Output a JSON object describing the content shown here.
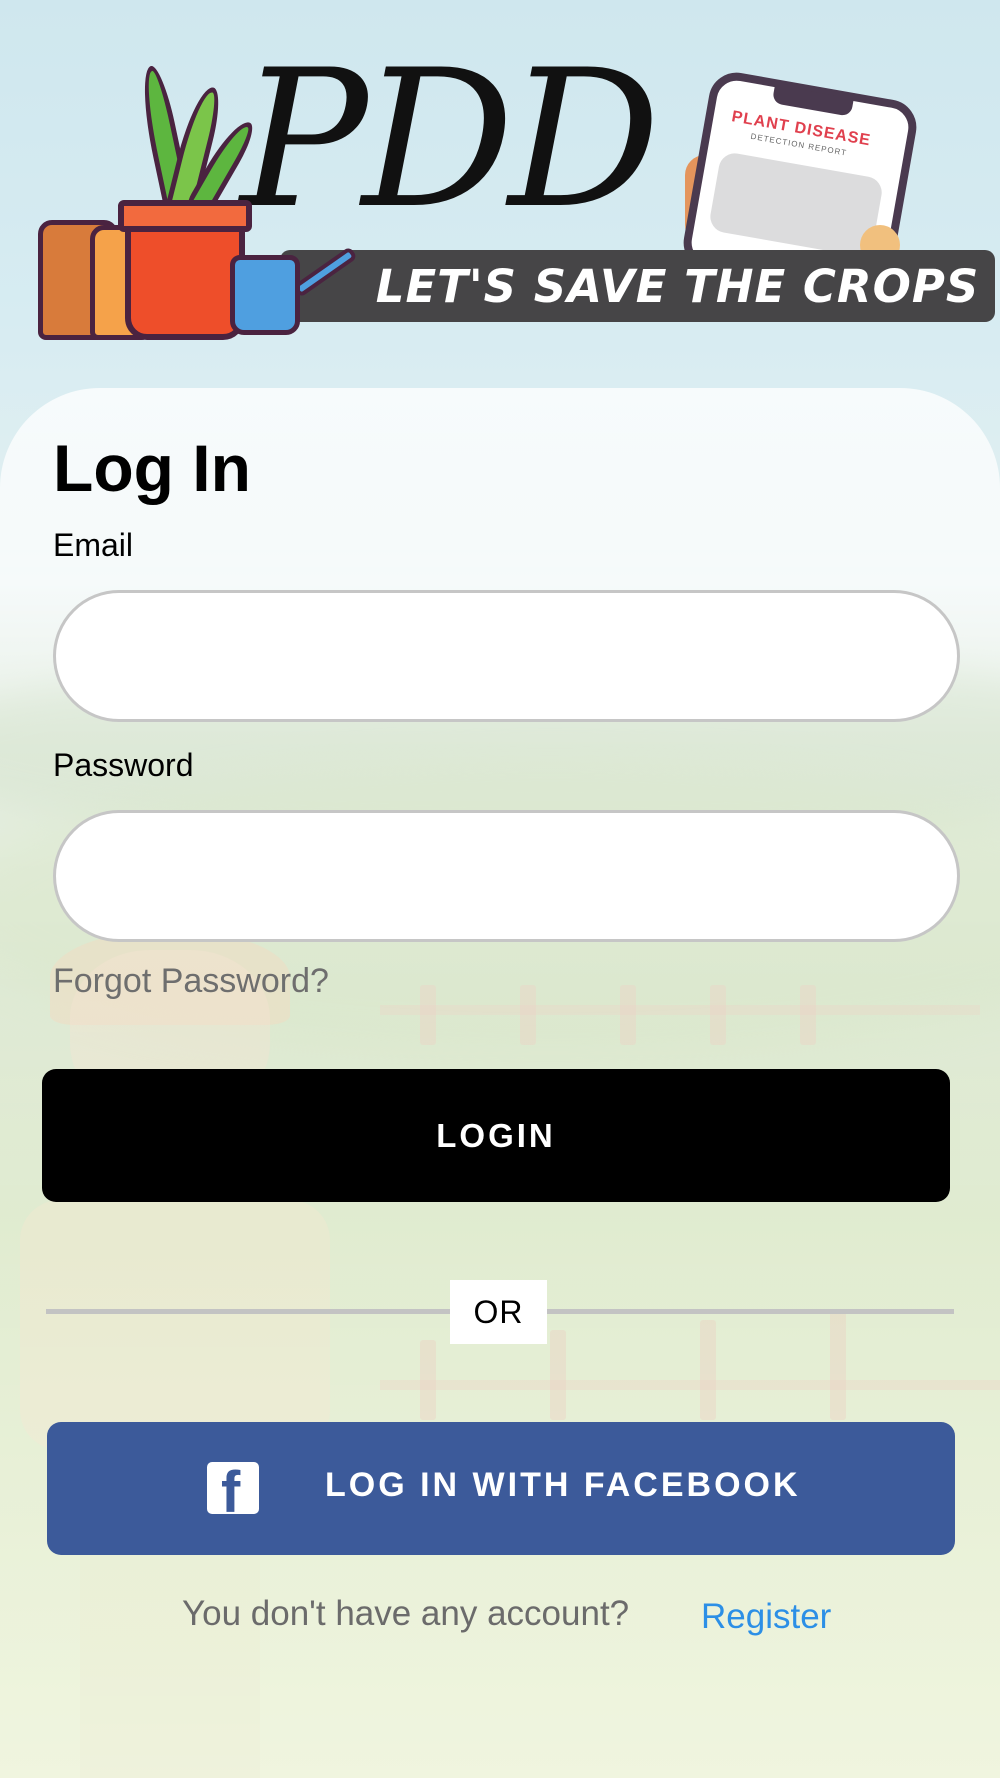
{
  "header": {
    "brand": "PDD",
    "tagline": "LET'S SAVE THE CROPS",
    "phone_title": "PLANT DISEASE",
    "phone_subtitle": "DETECTION REPORT"
  },
  "login_form": {
    "title": "Log In",
    "email_label": "Email",
    "email_value": "",
    "password_label": "Password",
    "password_value": "",
    "forgot_password": "Forgot Password?",
    "login_button": "LOGIN",
    "or_text": "OR",
    "facebook_icon_glyph": "f",
    "facebook_button": "LOG IN WITH FACEBOOK",
    "no_account_text": "You don't have any account?",
    "register_link": "Register"
  },
  "colors": {
    "login_button_bg": "#000000",
    "facebook_bg": "#3c5a9a",
    "register_link": "#2c8fe6",
    "tagline_banner": "#464547"
  }
}
